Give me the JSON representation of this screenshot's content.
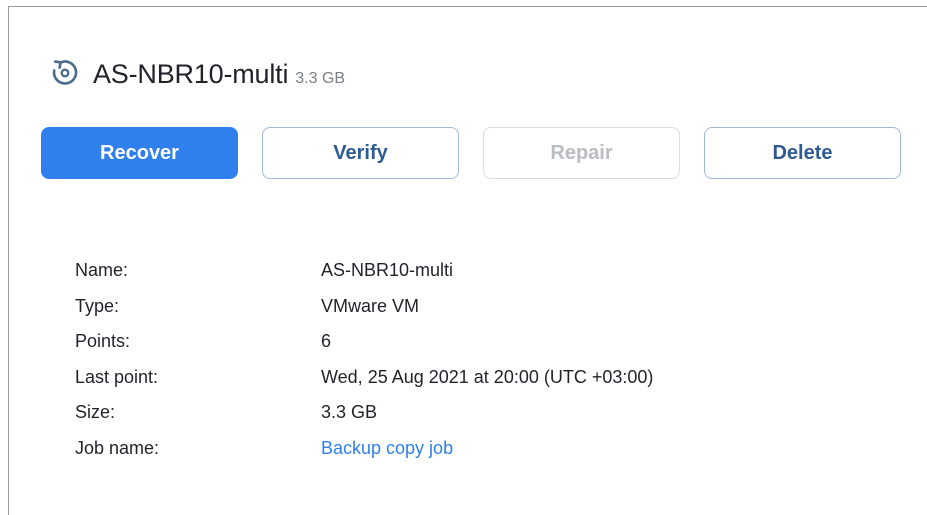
{
  "header": {
    "icon": "restore-icon",
    "title": "AS-NBR10-multi",
    "size": "3.3 GB"
  },
  "actions": {
    "recover": "Recover",
    "verify": "Verify",
    "repair": "Repair",
    "delete": "Delete"
  },
  "details": {
    "name_label": "Name:",
    "name_value": "AS-NBR10-multi",
    "type_label": "Type:",
    "type_value": "VMware VM",
    "points_label": "Points:",
    "points_value": "6",
    "last_point_label": "Last point:",
    "last_point_value": "Wed, 25 Aug 2021 at 20:00 (UTC +03:00)",
    "size_label": "Size:",
    "size_value": "3.3 GB",
    "job_label": "Job name:",
    "job_value": "Backup copy job"
  },
  "colors": {
    "accent": "#2f80ed",
    "secondary_text": "#2f5b94",
    "disabled_text": "#b9bdc2",
    "link": "#2f80ed"
  }
}
